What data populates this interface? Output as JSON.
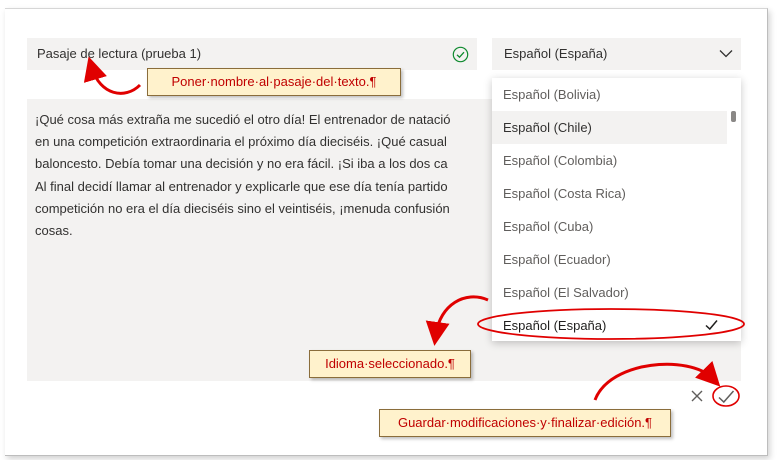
{
  "editor": {
    "title_value": "Pasaje de lectura (prueba 1)",
    "language_selected": "Español (España)",
    "passage_lines": [
      "¡Qué cosa más extraña me sucedió el otro día! El entrenador de natació",
      "en una competición extraordinaria el próximo día dieciséis. ¡Qué casual",
      "baloncesto. Debía tomar una decisión y no era fácil. ¡Si iba a los dos ca",
      "Al final decidí llamar al entrenador y explicarle que ese día tenía partido",
      "competición no era el día dieciséis sino el veintiséis, ¡menuda confusión",
      "cosas."
    ]
  },
  "language_dropdown": {
    "options": [
      "Español (Bolivia)",
      "Español (Chile)",
      "Español (Colombia)",
      "Español (Costa Rica)",
      "Español (Cuba)",
      "Español (Ecuador)",
      "Español (El Salvador)",
      "Español (España)"
    ],
    "hovered_option": "Español (Chile)",
    "selected_option": "Español (España)"
  },
  "actions": {
    "cancel_icon": "close-icon",
    "save_icon": "checkmark-circle-icon"
  },
  "annotations": {
    "title_callout": "Poner·nombre·al·pasaje·del·texto.¶",
    "language_callout": "Idioma·seleccionado.¶",
    "save_callout": "Guardar·modificaciones·y·finalizar·edición.¶"
  },
  "colors": {
    "field_background": "#f3f2f1",
    "valid_check": "#0e8a2e",
    "callout_background": "#fff2cc",
    "callout_text": "#c00000",
    "annotation_arrow": "#e00000"
  }
}
